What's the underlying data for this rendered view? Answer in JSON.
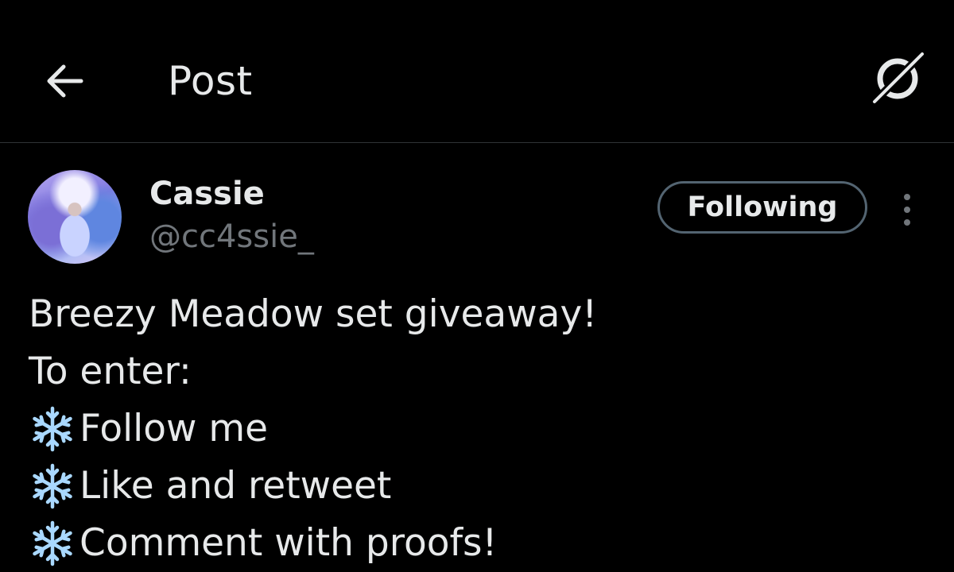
{
  "header": {
    "title": "Post",
    "back_icon": "arrow-left-icon",
    "grok_icon": "grok-icon"
  },
  "post": {
    "author": {
      "display_name": "Cassie",
      "handle": "@cc4ssie_"
    },
    "follow_label": "Following",
    "more_icon": "more-vertical-icon",
    "text": {
      "line1": "Breezy Meadow set giveaway!",
      "line2": "To enter:",
      "bullets": [
        "Follow me",
        "Like and retweet",
        "Comment with proofs!"
      ],
      "bullet_icon": "snowflake-icon"
    }
  },
  "colors": {
    "background": "#000000",
    "text": "#e7e9ea",
    "secondary_text": "#71767b",
    "border": "#2f3336",
    "button_border": "#536471",
    "snowflake": "#a9d8ff"
  }
}
